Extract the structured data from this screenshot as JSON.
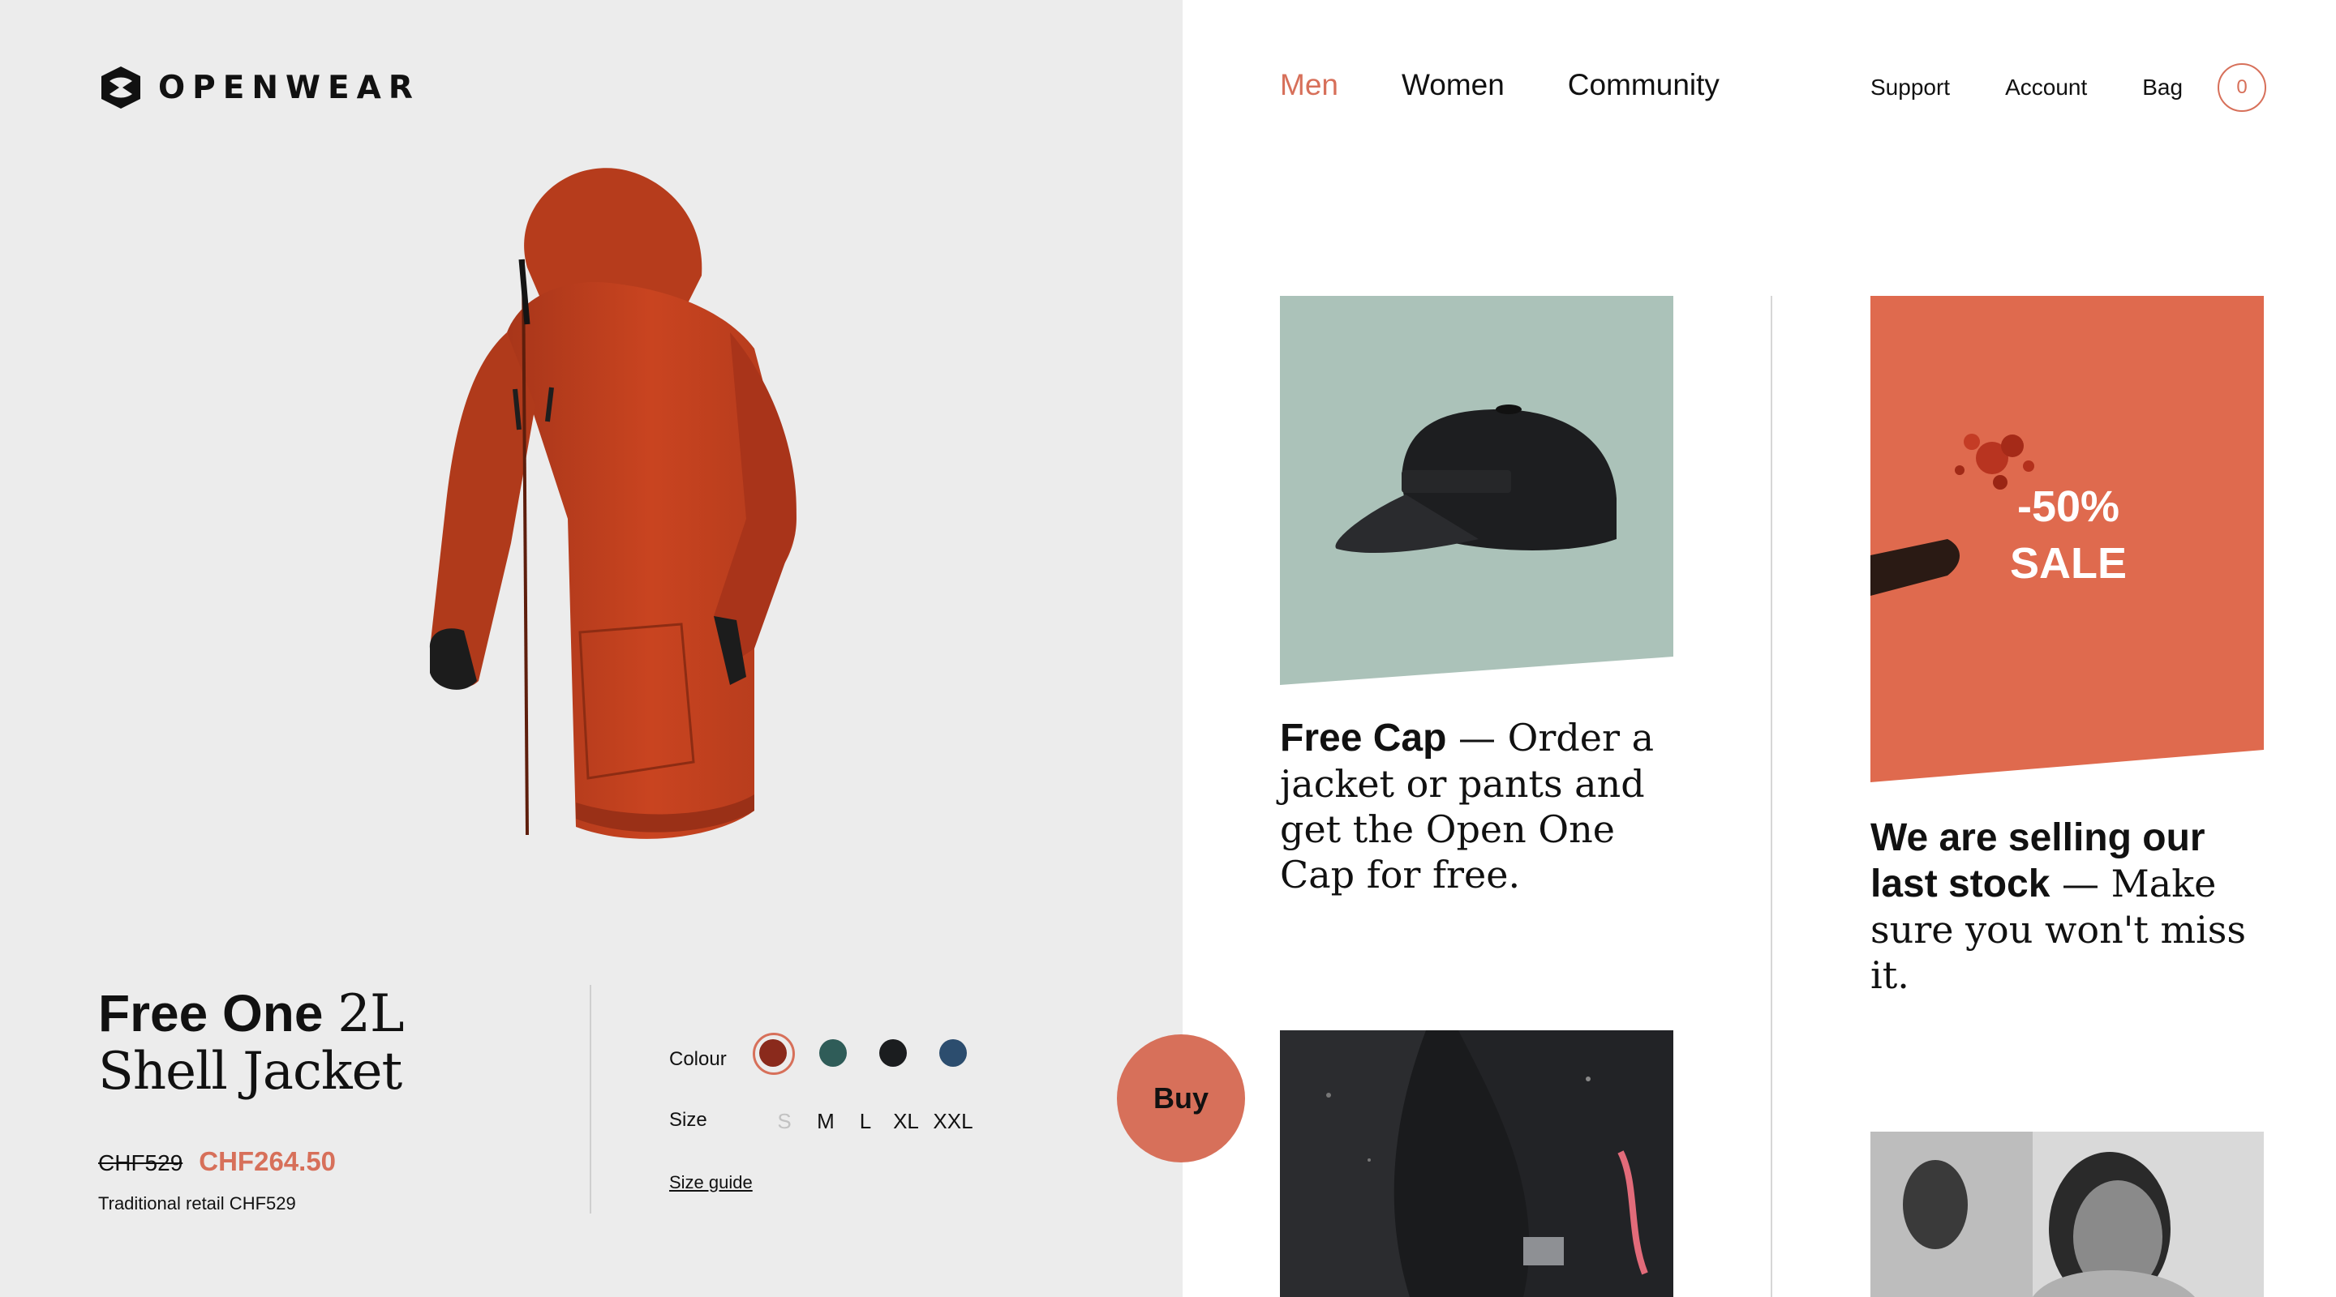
{
  "brand": {
    "name": "OPENWEAR"
  },
  "nav": {
    "main": [
      {
        "label": "Men",
        "active": true
      },
      {
        "label": "Women",
        "active": false
      },
      {
        "label": "Community",
        "active": false
      }
    ],
    "utility": [
      {
        "label": "Support"
      },
      {
        "label": "Account"
      },
      {
        "label": "Bag"
      }
    ],
    "bag_count": "0"
  },
  "product": {
    "title_bold": "Free One",
    "title_light_1": "2L",
    "title_light_2": "Shell Jacket",
    "old_price": "CHF529",
    "new_price": "CHF264.50",
    "retail_note": "Traditional retail CHF529",
    "colour_label": "Colour",
    "colours": [
      "#8a2a1c",
      "#2f5c58",
      "#1b1d1f",
      "#2c4d6e"
    ],
    "selected_colour_index": 0,
    "size_label": "Size",
    "sizes": [
      {
        "label": "S",
        "available": false
      },
      {
        "label": "M",
        "available": true
      },
      {
        "label": "L",
        "available": true
      },
      {
        "label": "XL",
        "available": true
      },
      {
        "label": "XXL",
        "available": true
      }
    ],
    "size_guide": "Size guide",
    "buy_label": "Buy",
    "jacket_color": "#c94420"
  },
  "promos": {
    "cap": {
      "lead": "Free Cap",
      "text": " — Order a jacket or pants and get the Open One Cap for free."
    },
    "sale": {
      "badge_line1": "-50%",
      "badge_line2": "SALE",
      "lead": "We are selling our last stock",
      "text": " — Make sure you won't miss it."
    }
  },
  "colors": {
    "accent": "#d7705a",
    "left_bg": "#ececec",
    "cap_bg": "#abc2b9",
    "sale_bg": "#df6a4e"
  }
}
